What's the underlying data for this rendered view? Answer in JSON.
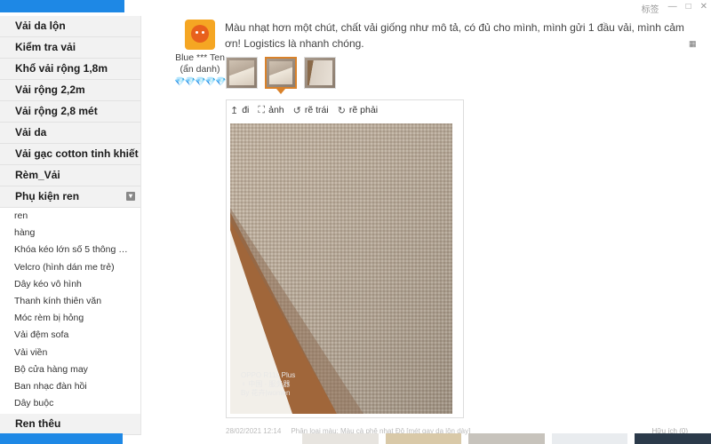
{
  "window": {
    "top_right_label": "标签",
    "minimize": "—",
    "restore": "□",
    "close": "✕"
  },
  "sidebar": {
    "categories": [
      {
        "label": "Vải da lộn"
      },
      {
        "label": "Kiểm tra vải"
      },
      {
        "label": "Khổ vải rộng 1,8m"
      },
      {
        "label": "Vải rộng 2,2m"
      },
      {
        "label": "Vải rộng 2,8 mét"
      },
      {
        "label": "Vải da"
      },
      {
        "label": "Vải gạc cotton tinh khiết"
      },
      {
        "label": "Rèm_Vải"
      },
      {
        "label": "Phụ kiện ren"
      }
    ],
    "subitems": [
      "ren",
      "hàng",
      "Khóa kéo lớn số 5 thông t…",
      "Velcro (hình dán me trẻ)",
      "Dây kéo vô hình",
      "Thanh kính thiên văn",
      "Móc rèm bị hỏng",
      "Vải đệm sofa",
      "Vải viền",
      "Bộ cửa hàng may",
      "Ban nhạc đàn hồi",
      "Dây buộc"
    ],
    "bottom_category": "Ren thêu"
  },
  "review": {
    "reviewer_name": "Blue *** Ten (ẩn danh)",
    "badge_icons": "💎💎💎💎💎",
    "text": "Màu nhạt hơn một chút, chất vải giống như mô tả, có đủ cho mình, mình gửi 1 đầu vải, mình cảm ơn! Logistics là nhanh chóng.",
    "viewer_toolbar": {
      "go": "đi",
      "image": "ảnh",
      "rotate_left": "rẽ trái",
      "rotate_right": "rẽ phải"
    },
    "photo_watermark": {
      "line1": "OPPO R11s Plus",
      "line2": "♀ 中国 · 服务器",
      "line3": "By 花卉|women"
    },
    "meta": {
      "date": "28/02/2021 12:14",
      "variant": "Phân loại màu: Màu cà phê nhạt Độ [mét gay da lộn dày]",
      "helpful": "Hữu ích (0)"
    }
  },
  "colors": {
    "accent_blue": "#1e88e5",
    "active_thumb_border": "#d9822b",
    "sidebar_bg": "#f2f2f2"
  }
}
